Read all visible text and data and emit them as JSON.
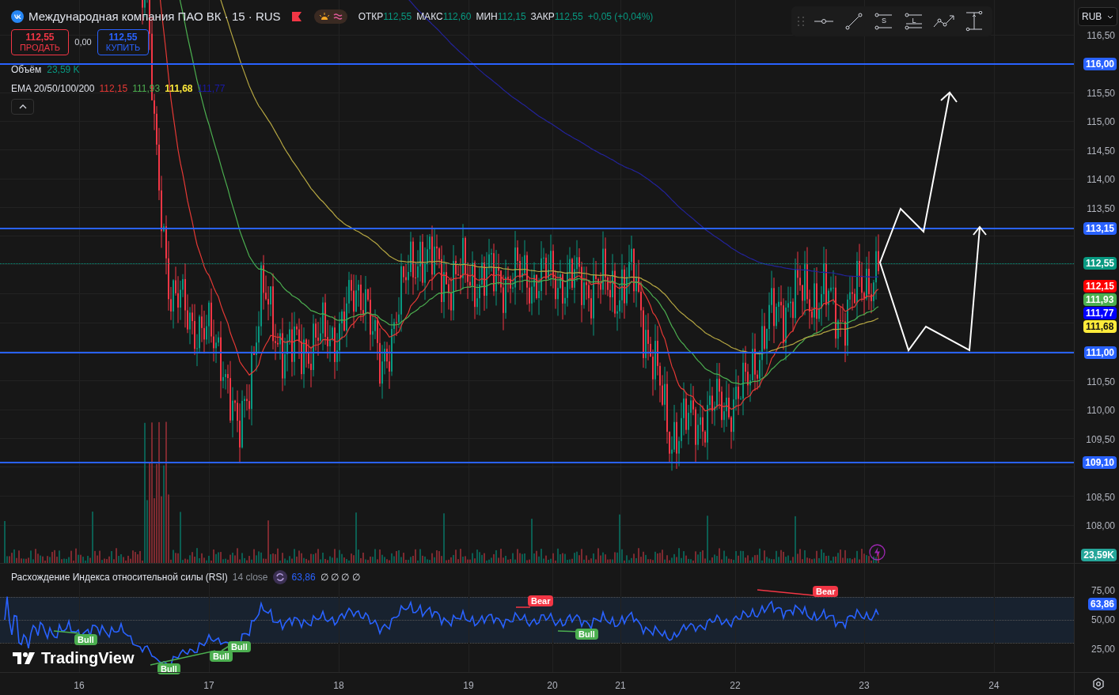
{
  "legend": {
    "title": "Международная компания ПАО ВК · 15 · RUS",
    "ohlc": [
      {
        "label": "ОТКР",
        "value": "112,55"
      },
      {
        "label": "МАКС",
        "value": "112,60"
      },
      {
        "label": "МИН",
        "value": "112,15"
      },
      {
        "label": "ЗАКР",
        "value": "112,55"
      }
    ],
    "change": "+0,05 (+0,04%)",
    "sell": {
      "price": "112,55",
      "label": "ПРОДАТЬ"
    },
    "spread": "0,00",
    "buy": {
      "price": "112,55",
      "label": "КУПИТЬ"
    },
    "volume": {
      "label": "Объём",
      "value": "23,59 K"
    },
    "ema": {
      "label": "EMA 20/50/100/200",
      "values": [
        {
          "value": "112,15",
          "color": "#e53935"
        },
        {
          "value": "111,93",
          "color": "#4caf50"
        },
        {
          "value": "111,68",
          "color": "#ffeb3b"
        },
        {
          "value": "111,77",
          "color": "#1a1aa8"
        }
      ]
    }
  },
  "drawing_tools": [
    {
      "kind": "horizontal-ray"
    },
    {
      "kind": "trend-line"
    },
    {
      "kind": "short-position",
      "letter": "S"
    },
    {
      "kind": "long-position",
      "letter": "L"
    },
    {
      "kind": "path"
    },
    {
      "kind": "price-range"
    }
  ],
  "price_axis": {
    "currency": "RUB",
    "ticks": [
      "116,50",
      "115,50",
      "115,00",
      "114,50",
      "114,00",
      "113,50",
      "110,50",
      "110,00",
      "109,50",
      "108,50",
      "108,00"
    ],
    "level_lines": [
      "116,00",
      "113,15",
      "111,00",
      "109,10"
    ],
    "last_price": "112,55",
    "ema_markers": [
      {
        "value": "112,15",
        "color": "#ff0000"
      },
      {
        "value": "111,93",
        "color": "#4caf50"
      },
      {
        "value": "111,77",
        "color": "#0000ff"
      },
      {
        "value": "111,68",
        "color": "#ffeb3b"
      }
    ],
    "volume_marker": "23,59K"
  },
  "rsi": {
    "title": "Расхождение Индекса относительной силы (RSI)",
    "params": "14 close",
    "value": "63,86",
    "extras": "∅ ∅ ∅ ∅",
    "ticks": [
      "75,00",
      "50,00",
      "25,00"
    ],
    "marker": "63,86",
    "divergences": [
      {
        "kind": "bull",
        "text": "Bull"
      },
      {
        "kind": "bull",
        "text": "Bull"
      },
      {
        "kind": "bull",
        "text": "Bull"
      },
      {
        "kind": "bull",
        "text": "Bull"
      },
      {
        "kind": "bear",
        "text": "Bear"
      },
      {
        "kind": "bull",
        "text": "Bull"
      },
      {
        "kind": "bear",
        "text": "Bear"
      }
    ]
  },
  "logo": "TradingView",
  "time_axis": [
    "16",
    "17",
    "18",
    "19",
    "20",
    "21",
    "22",
    "23",
    "24"
  ]
}
